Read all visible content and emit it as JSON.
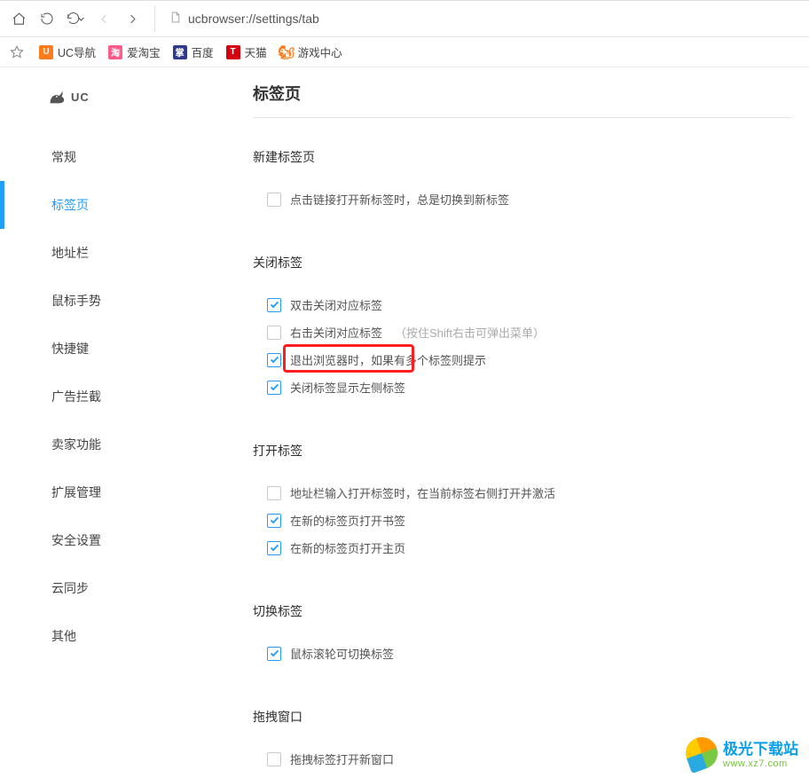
{
  "toolbar": {
    "url": "ucbrowser://settings/tab"
  },
  "bookmarks": [
    {
      "label": "UC导航",
      "favicon": "U",
      "cls": "fi-orange"
    },
    {
      "label": "爱淘宝",
      "favicon": "淘",
      "cls": "fi-pink"
    },
    {
      "label": "百度",
      "favicon": "掌",
      "cls": "fi-blue"
    },
    {
      "label": "天猫",
      "favicon": "T",
      "cls": "fi-red"
    },
    {
      "label": "游戏中心",
      "favicon": "🐿",
      "cls": "fi-squirrel"
    }
  ],
  "brand": {
    "name": "UC"
  },
  "sidebar": {
    "items": [
      {
        "label": "常规"
      },
      {
        "label": "标签页"
      },
      {
        "label": "地址栏"
      },
      {
        "label": "鼠标手势"
      },
      {
        "label": "快捷键"
      },
      {
        "label": "广告拦截"
      },
      {
        "label": "卖家功能"
      },
      {
        "label": "扩展管理"
      },
      {
        "label": "安全设置"
      },
      {
        "label": "云同步"
      },
      {
        "label": "其他"
      }
    ],
    "activeIndex": 1
  },
  "page": {
    "title": "标签页"
  },
  "sections": {
    "new_tab": {
      "title": "新建标签页",
      "opts": [
        {
          "checked": false,
          "label": "点击链接打开新标签时，总是切换到新标签"
        }
      ]
    },
    "close_tab": {
      "title": "关闭标签",
      "opts": [
        {
          "checked": true,
          "label": "双击关闭对应标签"
        },
        {
          "checked": false,
          "label": "右击关闭对应标签",
          "hint": "（按住Shift右击可弹出菜单）"
        },
        {
          "checked": true,
          "label": "退出浏览器时，如果有多个标签则提示"
        },
        {
          "checked": true,
          "label": "关闭标签显示左侧标签"
        }
      ]
    },
    "open_tab": {
      "title": "打开标签",
      "opts": [
        {
          "checked": false,
          "label": "地址栏输入打开标签时，在当前标签右侧打开并激活"
        },
        {
          "checked": true,
          "label": "在新的标签页打开书签"
        },
        {
          "checked": true,
          "label": "在新的标签页打开主页"
        }
      ]
    },
    "switch_tab": {
      "title": "切换标签",
      "opts": [
        {
          "checked": true,
          "label": "鼠标滚轮可切换标签"
        }
      ]
    },
    "drag_window": {
      "title": "拖拽窗口",
      "opts": [
        {
          "checked": false,
          "label": "拖拽标签打开新窗口"
        }
      ]
    }
  },
  "watermark": {
    "line1": "极光下载站",
    "line2": "www.xz7.com"
  }
}
